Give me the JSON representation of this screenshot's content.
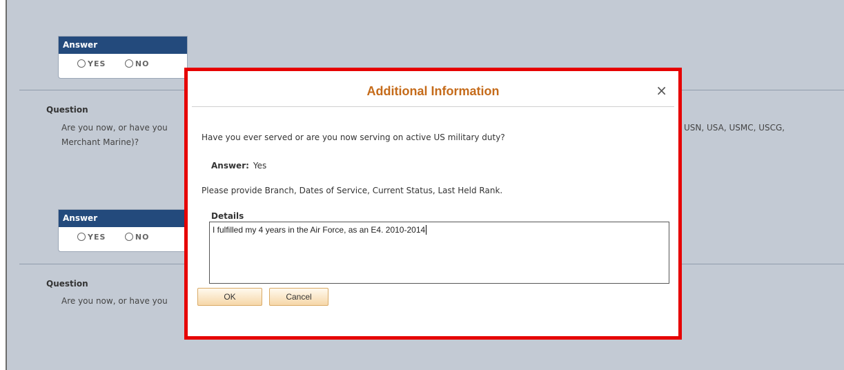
{
  "page": {
    "answer_section_1": {
      "header": "Answer",
      "yes_label": "YES",
      "no_label": "NO"
    },
    "question_1": {
      "label": "Question",
      "text_left_line1": "Are you now, or have you",
      "text_right_line1": "USN, USA, USMC, USCG,",
      "text_line2": "Merchant Marine)?"
    },
    "answer_section_2": {
      "header": "Answer",
      "yes_label": "YES",
      "no_label": "NO"
    },
    "question_2": {
      "label": "Question",
      "text_left_line1": "Are you now, or have you"
    }
  },
  "modal": {
    "title": "Additional Information",
    "close_glyph": "×",
    "question_text": "Have you ever served or are you now serving on active US military duty?",
    "answer_label": "Answer:",
    "answer_value": "Yes",
    "instructions": "Please provide Branch, Dates of Service, Current Status, Last Held Rank.",
    "details_label": "Details",
    "details_value": "I fulfilled my 4 years in the Air Force, as an E4.  2010-2014",
    "ok_label": "OK",
    "cancel_label": "Cancel"
  },
  "colors": {
    "page_bg": "#c3cad4",
    "answer_header_bg": "#234a7c",
    "modal_title": "#c56b1a",
    "highlight_border": "#e60000"
  }
}
